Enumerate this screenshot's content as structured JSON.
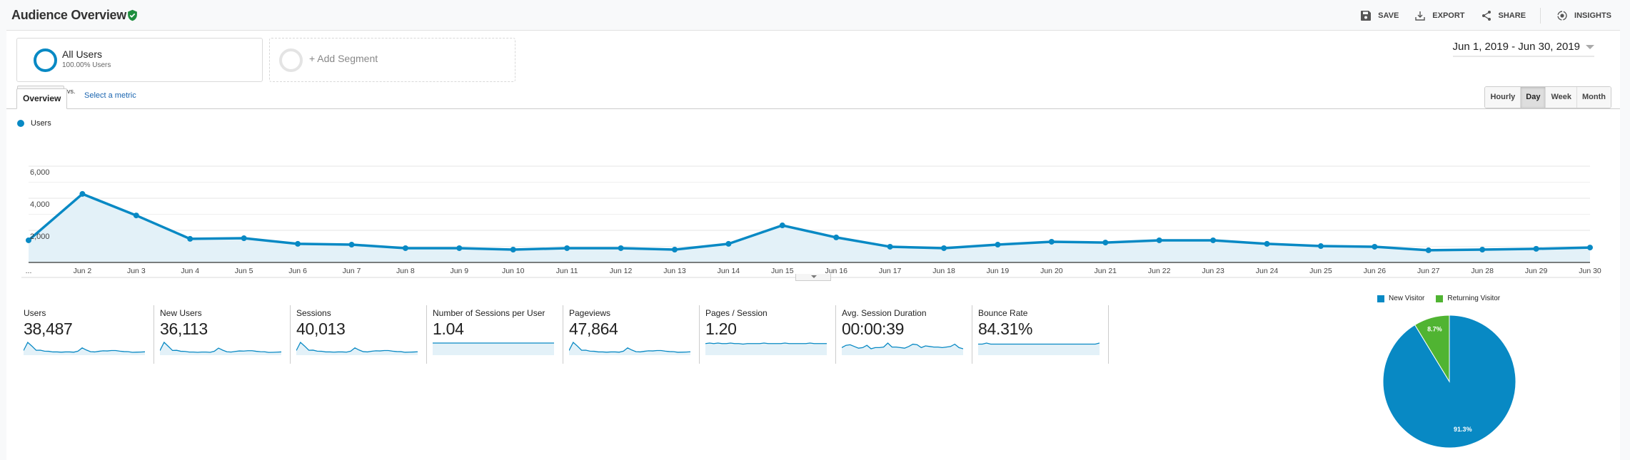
{
  "header": {
    "title": "Audience Overview",
    "actions": [
      {
        "label": "SAVE",
        "icon": "save-icon"
      },
      {
        "label": "EXPORT",
        "icon": "export-icon"
      },
      {
        "label": "SHARE",
        "icon": "share-icon"
      },
      {
        "label": "INSIGHTS",
        "icon": "insights-icon"
      }
    ]
  },
  "segments": {
    "active": {
      "name": "All Users",
      "sub": "100.00% Users"
    },
    "add_label": "+ Add Segment"
  },
  "date_range": "Jun 1, 2019 - Jun 30, 2019",
  "tabs": [
    {
      "label": "Overview"
    }
  ],
  "metric_controls": {
    "selected_metric": "Users",
    "vs_label": "vs.",
    "select_metric_link": "Select a metric"
  },
  "granularity": {
    "options": [
      "Hourly",
      "Day",
      "Week",
      "Month"
    ],
    "active": "Day"
  },
  "colors": {
    "primary": "#0889c4",
    "fill": "#e3f1f8",
    "returning": "#50b432"
  },
  "chart_data": [
    {
      "type": "area",
      "title": "",
      "legend": [
        "Users"
      ],
      "legend_position": "top-left",
      "ylim": [
        0,
        6000
      ],
      "yticks": [
        "2,000",
        "4,000",
        "6,000"
      ],
      "ytick_values": [
        2000,
        4000,
        6000
      ],
      "grid": true,
      "categories": [
        "...",
        "Jun 2",
        "Jun 3",
        "Jun 4",
        "Jun 5",
        "Jun 6",
        "Jun 7",
        "Jun 8",
        "Jun 9",
        "Jun 10",
        "Jun 11",
        "Jun 12",
        "Jun 13",
        "Jun 14",
        "Jun 15",
        "Jun 16",
        "Jun 17",
        "Jun 18",
        "Jun 19",
        "Jun 20",
        "Jun 21",
        "Jun 22",
        "Jun 23",
        "Jun 24",
        "Jun 25",
        "Jun 26",
        "Jun 27",
        "Jun 28",
        "Jun 29",
        "Jun 30"
      ],
      "series": [
        {
          "name": "Users",
          "values": [
            1380,
            4270,
            2930,
            1470,
            1510,
            1160,
            1110,
            890,
            890,
            800,
            890,
            890,
            800,
            1160,
            2310,
            1560,
            980,
            890,
            1110,
            1290,
            1240,
            1380,
            1380,
            1160,
            1020,
            980,
            760,
            800,
            850,
            930
          ]
        }
      ]
    },
    {
      "type": "pie",
      "title": "",
      "legend": [
        "New Visitor",
        "Returning Visitor"
      ],
      "legend_position": "top",
      "slices": [
        {
          "label": "New Visitor",
          "value": 91.3,
          "display": "91.3%"
        },
        {
          "label": "Returning Visitor",
          "value": 8.7,
          "display": "8.7%"
        }
      ]
    }
  ],
  "metrics": [
    {
      "label": "Users",
      "value": "38,487",
      "spark": [
        1380,
        4270,
        2930,
        1470,
        1510,
        1160,
        1110,
        890,
        890,
        800,
        890,
        890,
        800,
        1160,
        2310,
        1560,
        980,
        890,
        1110,
        1290,
        1240,
        1380,
        1380,
        1160,
        1020,
        980,
        760,
        800,
        850,
        930
      ]
    },
    {
      "label": "New Users",
      "value": "36,113",
      "spark": [
        1300,
        4100,
        2750,
        1350,
        1400,
        1070,
        1020,
        820,
        820,
        730,
        820,
        820,
        730,
        1070,
        2150,
        1450,
        900,
        820,
        1020,
        1190,
        1140,
        1270,
        1270,
        1070,
        940,
        900,
        700,
        730,
        780,
        860
      ]
    },
    {
      "label": "Sessions",
      "value": "40,013",
      "spark": [
        1430,
        4420,
        3030,
        1530,
        1570,
        1210,
        1160,
        930,
        930,
        840,
        930,
        930,
        840,
        1210,
        2400,
        1620,
        1020,
        930,
        1160,
        1340,
        1290,
        1430,
        1430,
        1210,
        1060,
        1020,
        790,
        840,
        890,
        970
      ]
    },
    {
      "label": "Number of Sessions per User",
      "value": "1.04",
      "spark": [
        1.04,
        1.04,
        1.04,
        1.04,
        1.04,
        1.04,
        1.04,
        1.04,
        1.04,
        1.04,
        1.04,
        1.04,
        1.04,
        1.04,
        1.04,
        1.04,
        1.04,
        1.04,
        1.04,
        1.04,
        1.04,
        1.04,
        1.04,
        1.04,
        1.04,
        1.04,
        1.04,
        1.04,
        1.04,
        1.04
      ]
    },
    {
      "label": "Pageviews",
      "value": "47,864",
      "spark": [
        1720,
        5300,
        3640,
        1830,
        1880,
        1450,
        1380,
        1110,
        1110,
        1000,
        1110,
        1110,
        1000,
        1450,
        2870,
        1940,
        1220,
        1110,
        1380,
        1600,
        1540,
        1720,
        1720,
        1450,
        1270,
        1220,
        950,
        1000,
        1060,
        1160
      ]
    },
    {
      "label": "Pages / Session",
      "value": "1.20",
      "spark": [
        1.2,
        1.21,
        1.2,
        1.21,
        1.2,
        1.2,
        1.21,
        1.2,
        1.2,
        1.19,
        1.2,
        1.2,
        1.2,
        1.2,
        1.21,
        1.2,
        1.2,
        1.2,
        1.2,
        1.21,
        1.2,
        1.2,
        1.2,
        1.2,
        1.2,
        1.21,
        1.2,
        1.2,
        1.2,
        1.2
      ]
    },
    {
      "label": "Avg. Session Duration",
      "value": "00:00:39",
      "spark": [
        36,
        40,
        41,
        38,
        35,
        36,
        40,
        34,
        36,
        36,
        37,
        44,
        37,
        37,
        36,
        35,
        38,
        42,
        41,
        36,
        39,
        38,
        37,
        37,
        36,
        37,
        38,
        42,
        36,
        34
      ]
    },
    {
      "label": "Bounce Rate",
      "value": "84.31%",
      "spark": [
        84.3,
        84.3,
        84.4,
        84.3,
        84.3,
        84.3,
        84.3,
        84.3,
        84.3,
        84.3,
        84.3,
        84.3,
        84.3,
        84.3,
        84.3,
        84.3,
        84.3,
        84.3,
        84.3,
        84.3,
        84.3,
        84.3,
        84.3,
        84.3,
        84.3,
        84.3,
        84.3,
        84.3,
        84.3,
        84.4
      ]
    }
  ]
}
